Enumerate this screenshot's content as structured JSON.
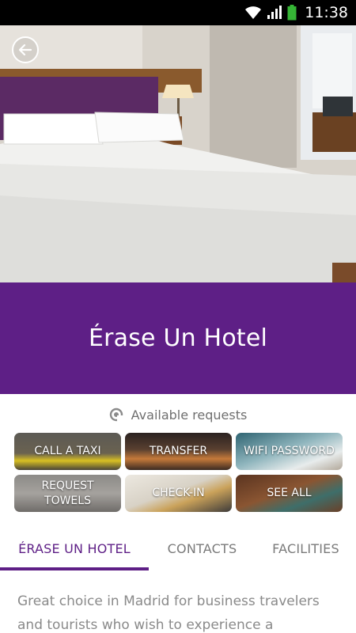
{
  "status_bar": {
    "time": "11:38",
    "icons": [
      "wifi-icon",
      "signal-icon",
      "battery-icon"
    ],
    "battery_color": "#35b535"
  },
  "hotel": {
    "name": "Érase Un Hotel",
    "brand_color": "#5e1f86"
  },
  "requests": {
    "header": "Available requests",
    "tiles": [
      {
        "label": "CALL A TAXI"
      },
      {
        "label": "TRANSFER"
      },
      {
        "label": "WIFI PASSWORD"
      },
      {
        "label": "REQUEST TOWELS"
      },
      {
        "label": "CHECK-IN"
      },
      {
        "label": "SEE ALL"
      }
    ]
  },
  "tabs": [
    {
      "label": "ÉRASE UN HOTEL",
      "active": true
    },
    {
      "label": "CONTACTS",
      "active": false
    },
    {
      "label": "FACILITIES",
      "active": false
    }
  ],
  "description": "Great choice in Madrid for business travelers and tourists who wish to experience a"
}
